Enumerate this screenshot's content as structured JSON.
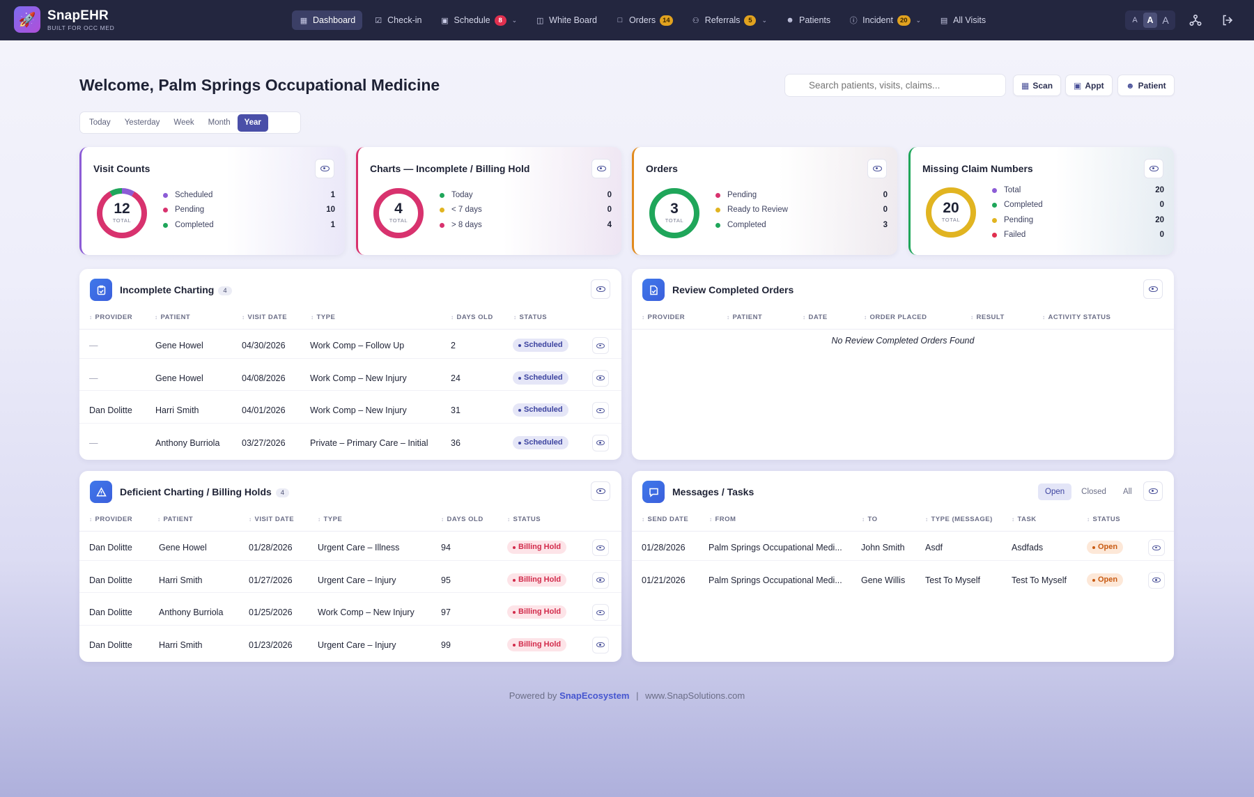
{
  "app": {
    "name": "SnapEHR",
    "tagline": "BUILT FOR OCC MED"
  },
  "nav": [
    {
      "label": "Dashboard",
      "icon": "grid-icon",
      "active": true
    },
    {
      "label": "Check-in",
      "icon": "checkbox-icon"
    },
    {
      "label": "Schedule",
      "icon": "calendar-icon",
      "badge": "8",
      "badge_color": "red",
      "dropdown": true
    },
    {
      "label": "White Board",
      "icon": "monitor-icon"
    },
    {
      "label": "Orders",
      "icon": "document-icon",
      "badge": "14",
      "badge_color": "amber"
    },
    {
      "label": "Referrals",
      "icon": "users-icon",
      "badge": "5",
      "badge_color": "amber",
      "dropdown": true
    },
    {
      "label": "Patients",
      "icon": "user-icon"
    },
    {
      "label": "Incident",
      "icon": "alert-circle-icon",
      "badge": "20",
      "badge_color": "amber",
      "dropdown": true
    },
    {
      "label": "All Visits",
      "icon": "list-icon"
    }
  ],
  "font_size": {
    "options": [
      "A",
      "A",
      "A"
    ],
    "selected_index": 1
  },
  "welcome": "Welcome, Palm Springs Occupational Medicine",
  "search": {
    "placeholder": "Search patients, visits, claims..."
  },
  "quick_actions": [
    {
      "label": "Scan",
      "icon": "scan-icon"
    },
    {
      "label": "Appt",
      "icon": "calendar-plus-icon"
    },
    {
      "label": "Patient",
      "icon": "user-plus-icon"
    }
  ],
  "periods": {
    "options": [
      "Today",
      "Yesterday",
      "Week",
      "Month",
      "Year"
    ],
    "selected": "Year"
  },
  "kpis": [
    {
      "title": "Visit Counts",
      "accent": "#8c5cd6",
      "total": "12",
      "total_label": "TOTAL",
      "items": [
        {
          "label": "Scheduled",
          "value": 1,
          "color": "#8c5cd6"
        },
        {
          "label": "Pending",
          "value": 10,
          "color": "#d8326e"
        },
        {
          "label": "Completed",
          "value": 1,
          "color": "#1fa65a"
        }
      ]
    },
    {
      "title": "Charts — Incomplete / Billing Hold",
      "accent": "#d8326e",
      "total": "4",
      "total_label": "TOTAL",
      "items": [
        {
          "label": "Today",
          "value": 0,
          "color": "#1fa65a"
        },
        {
          "label": "< 7 days",
          "value": 0,
          "color": "#e1b421"
        },
        {
          "label": "> 8 days",
          "value": 4,
          "color": "#d8326e"
        }
      ]
    },
    {
      "title": "Orders",
      "accent": "#e18b1f",
      "total": "3",
      "total_label": "TOTAL",
      "items": [
        {
          "label": "Pending",
          "value": 0,
          "color": "#d8326e"
        },
        {
          "label": "Ready to Review",
          "value": 0,
          "color": "#e1b421"
        },
        {
          "label": "Completed",
          "value": 3,
          "color": "#1fa65a"
        }
      ]
    },
    {
      "title": "Missing Claim Numbers",
      "accent": "#1fa65a",
      "total": "20",
      "total_label": "TOTAL",
      "items": [
        {
          "label": "Total",
          "value": 20,
          "color": "#8c5cd6"
        },
        {
          "label": "Completed",
          "value": 0,
          "color": "#1fa65a"
        },
        {
          "label": "Pending",
          "value": 20,
          "color": "#e1b421"
        },
        {
          "label": "Failed",
          "value": 0,
          "color": "#e0304f"
        }
      ]
    }
  ],
  "incomplete": {
    "title": "Incomplete Charting",
    "count": "4",
    "columns": [
      "PROVIDER",
      "PATIENT",
      "VISIT DATE",
      "TYPE",
      "DAYS OLD",
      "STATUS"
    ],
    "rows": [
      {
        "provider": "—",
        "patient": "Gene Howel",
        "visit_date": "04/30/2026",
        "type": "Work Comp – Follow Up",
        "days_old": "2",
        "status": "Scheduled"
      },
      {
        "provider": "—",
        "patient": "Gene Howel",
        "visit_date": "04/08/2026",
        "type": "Work Comp – New Injury",
        "days_old": "24",
        "status": "Scheduled"
      },
      {
        "provider": "Dan Dolitte",
        "patient": "Harri Smith",
        "visit_date": "04/01/2026",
        "type": "Work Comp – New Injury",
        "days_old": "31",
        "status": "Scheduled"
      },
      {
        "provider": "—",
        "patient": "Anthony Burriola",
        "visit_date": "03/27/2026",
        "type": "Private – Primary Care – Initial",
        "days_old": "36",
        "status": "Scheduled"
      }
    ]
  },
  "review": {
    "title": "Review Completed Orders",
    "columns": [
      "PROVIDER",
      "PATIENT",
      "DATE",
      "ORDER PLACED",
      "RESULT",
      "ACTIVITY STATUS"
    ],
    "empty": "No Review Completed Orders Found"
  },
  "deficient": {
    "title": "Deficient Charting / Billing Holds",
    "count": "4",
    "columns": [
      "PROVIDER",
      "PATIENT",
      "VISIT DATE",
      "TYPE",
      "DAYS OLD",
      "STATUS"
    ],
    "rows": [
      {
        "provider": "Dan Dolitte",
        "patient": "Gene Howel",
        "visit_date": "01/28/2026",
        "type": "Urgent Care – Illness",
        "days_old": "94",
        "status": "Billing Hold"
      },
      {
        "provider": "Dan Dolitte",
        "patient": "Harri Smith",
        "visit_date": "01/27/2026",
        "type": "Urgent Care – Injury",
        "days_old": "95",
        "status": "Billing Hold"
      },
      {
        "provider": "Dan Dolitte",
        "patient": "Anthony Burriola",
        "visit_date": "01/25/2026",
        "type": "Work Comp – New Injury",
        "days_old": "97",
        "status": "Billing Hold"
      },
      {
        "provider": "Dan Dolitte",
        "patient": "Harri Smith",
        "visit_date": "01/23/2026",
        "type": "Urgent Care – Injury",
        "days_old": "99",
        "status": "Billing Hold"
      }
    ]
  },
  "messages": {
    "title": "Messages / Tasks",
    "tabs": [
      "Open",
      "Closed",
      "All"
    ],
    "selected_tab": "Open",
    "columns": [
      "SEND DATE",
      "FROM",
      "TO",
      "TYPE (MESSAGE)",
      "TASK",
      "STATUS"
    ],
    "rows": [
      {
        "send_date": "01/28/2026",
        "from": "Palm Springs Occupational Medi...",
        "to": "John Smith",
        "type": "Asdf",
        "task": "Asdfads",
        "status": "Open"
      },
      {
        "send_date": "01/21/2026",
        "from": "Palm Springs Occupational Medi...",
        "to": "Gene Willis",
        "type": "Test To Myself",
        "task": "Test To Myself",
        "status": "Open"
      }
    ]
  },
  "footer": {
    "prefix": "Powered by",
    "link": "SnapEcosystem",
    "sep": "|",
    "site": "www.SnapSolutions.com"
  }
}
